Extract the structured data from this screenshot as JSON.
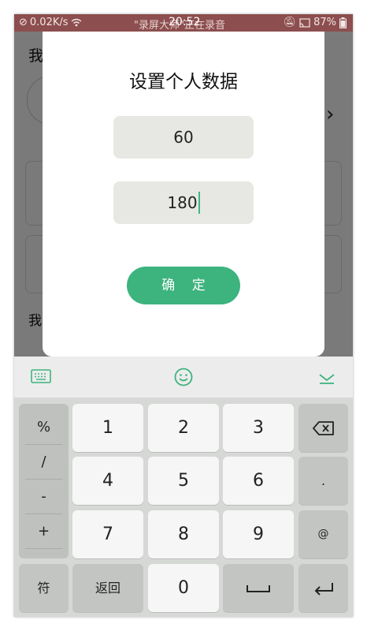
{
  "status_bar": {
    "speed": "0.02K/s",
    "recording_text": "\"录屏大师\"正在录音",
    "time": "20:52",
    "battery": "87%"
  },
  "background_page": {
    "title_partial": "我",
    "section_partial": "我"
  },
  "dialog": {
    "title": "设置个人数据",
    "field1_value": "60",
    "field2_value": "180",
    "confirm_label": "确 定"
  },
  "keyboard": {
    "symbols": [
      "%",
      "/",
      "-",
      "+"
    ],
    "rows": [
      [
        "1",
        "2",
        "3"
      ],
      [
        "4",
        "5",
        "6"
      ],
      [
        "7",
        "8",
        "9"
      ]
    ],
    "right_keys": [
      ".",
      "@"
    ],
    "fu_label": "符",
    "back_label": "返回",
    "zero_label": "0"
  },
  "colors": {
    "accent_green": "#3db37e",
    "status_bar": "#8c4e4e"
  }
}
